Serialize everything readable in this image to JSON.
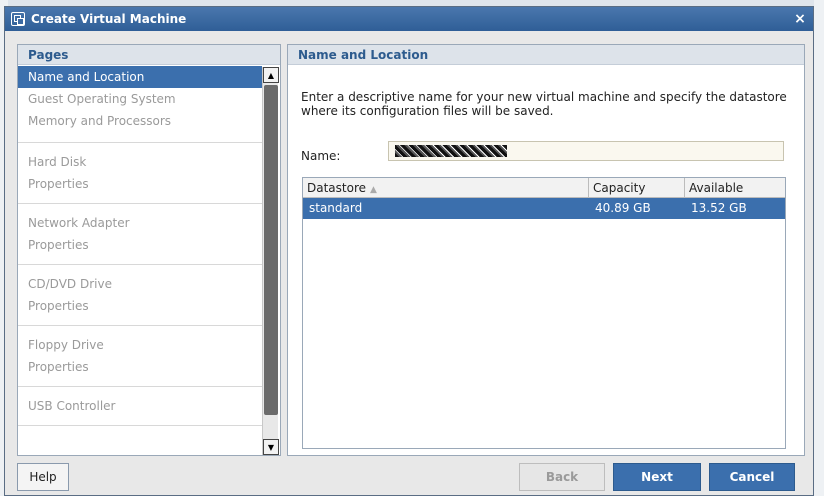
{
  "window": {
    "title": "Create Virtual Machine",
    "close_glyph": "×",
    "icon": "vm-icon"
  },
  "pages_panel": {
    "header": "Pages",
    "groups": [
      {
        "items": [
          {
            "label": "Name and Location",
            "active": true
          },
          {
            "label": "Guest Operating System",
            "active": false
          },
          {
            "label": "Memory and Processors",
            "active": false
          }
        ]
      },
      {
        "items": [
          {
            "label": "Hard Disk",
            "active": false
          },
          {
            "label": "Properties",
            "active": false
          }
        ]
      },
      {
        "items": [
          {
            "label": "Network Adapter",
            "active": false
          },
          {
            "label": "Properties",
            "active": false
          }
        ]
      },
      {
        "items": [
          {
            "label": "CD/DVD Drive",
            "active": false
          },
          {
            "label": "Properties",
            "active": false
          }
        ]
      },
      {
        "items": [
          {
            "label": "Floppy Drive",
            "active": false
          },
          {
            "label": "Properties",
            "active": false
          }
        ]
      },
      {
        "items": [
          {
            "label": "USB Controller",
            "active": false
          }
        ]
      }
    ]
  },
  "content": {
    "header": "Name and Location",
    "description": "Enter a descriptive name for your new virtual machine and specify the datastore where its configuration files will be saved.",
    "name_label": "Name:",
    "name_value": "",
    "table": {
      "columns": [
        "Datastore",
        "Capacity",
        "Available"
      ],
      "rows": [
        {
          "datastore": "standard",
          "capacity": "40.89 GB",
          "available": "13.52 GB",
          "selected": true
        }
      ]
    }
  },
  "buttons": {
    "help": "Help",
    "back": "Back",
    "next": "Next",
    "cancel": "Cancel"
  }
}
